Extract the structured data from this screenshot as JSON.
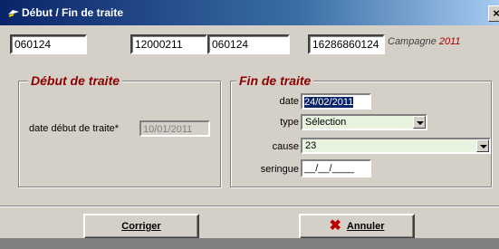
{
  "window": {
    "title": "Début / Fin de traite",
    "close_glyph": "×"
  },
  "top": {
    "field1": "060124",
    "field2": "12000211",
    "field3": "060124",
    "field4": "16286860124",
    "campagne_label": "Campagne",
    "campagne_year": "2011"
  },
  "debut": {
    "legend": "Début de traite",
    "date_label": "date début de traite*",
    "date_value": "10/01/2011"
  },
  "fin": {
    "legend": "Fin de traite",
    "date_label": "date",
    "date_value": "24/02/2011",
    "type_label": "type",
    "type_value": "Sélection",
    "cause_label": "cause",
    "cause_value": "23",
    "seringue_label": "seringue",
    "seringue_value": "__/__/____"
  },
  "buttons": {
    "corriger_label": "Corriger",
    "annuler_label": "Annuler"
  },
  "colors": {
    "accent_red": "#8b0000",
    "title_bar": "#0a246a",
    "combo_bg": "#e8f3e0"
  },
  "icons": {
    "title": "app-icon",
    "annuler": "red-x-icon"
  }
}
